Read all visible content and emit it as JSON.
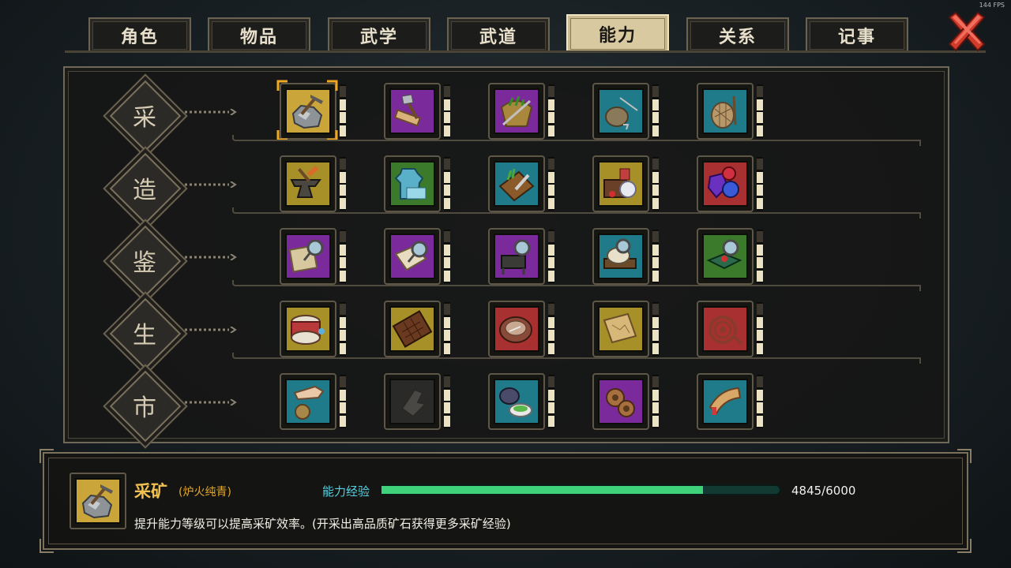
{
  "fps": "144 FPS",
  "tabs": [
    {
      "label": "角色",
      "active": false
    },
    {
      "label": "物品",
      "active": false
    },
    {
      "label": "武学",
      "active": false
    },
    {
      "label": "武道",
      "active": false
    },
    {
      "label": "能力",
      "active": true
    },
    {
      "label": "关系",
      "active": false
    },
    {
      "label": "记事",
      "active": false
    }
  ],
  "close_icon": "close-x-icon",
  "categories": [
    {
      "label": "采",
      "skills": [
        {
          "icon": "mining-pickaxe-ore-icon",
          "frame": "#c9a53a",
          "pips": 3,
          "selected": true
        },
        {
          "icon": "logging-axe-wood-icon",
          "frame": "#7a2a9a",
          "pips": 3
        },
        {
          "icon": "herb-basket-sickle-icon",
          "frame": "#7a2a9a",
          "pips": 3
        },
        {
          "icon": "fishing-rod-bag-icon",
          "frame": "#1f7a8a",
          "pips": 3
        },
        {
          "icon": "hunting-net-icon",
          "frame": "#1f7a8a",
          "pips": 3
        }
      ]
    },
    {
      "label": "造",
      "skills": [
        {
          "icon": "anvil-hammer-icon",
          "frame": "#a89028",
          "pips": 3
        },
        {
          "icon": "tailoring-cloth-icon",
          "frame": "#3a7a2a",
          "pips": 3
        },
        {
          "icon": "cooking-board-knife-icon",
          "frame": "#1f7a8a",
          "pips": 3
        },
        {
          "icon": "alchemy-potions-icon",
          "frame": "#a89028",
          "pips": 3
        },
        {
          "icon": "jewel-crafting-gems-icon",
          "frame": "#a83030",
          "pips": 3
        }
      ]
    },
    {
      "label": "鉴",
      "skills": [
        {
          "icon": "appraise-scroll-icon",
          "frame": "#7a2a9a",
          "pips": 3
        },
        {
          "icon": "appraise-book-icon",
          "frame": "#7a2a9a",
          "pips": 3
        },
        {
          "icon": "appraise-weapon-rack-icon",
          "frame": "#7a2a9a",
          "pips": 3
        },
        {
          "icon": "appraise-relic-icon",
          "frame": "#1f7a8a",
          "pips": 3
        },
        {
          "icon": "appraise-jewelry-box-icon",
          "frame": "#3a7a2a",
          "pips": 3
        }
      ]
    },
    {
      "label": "生",
      "skills": [
        {
          "icon": "drum-instrument-icon",
          "frame": "#a89028",
          "pips": 3
        },
        {
          "icon": "chocolate-bar-icon",
          "frame": "#a89028",
          "pips": 3
        },
        {
          "icon": "bowl-dish-icon",
          "frame": "#a83030",
          "pips": 3
        },
        {
          "icon": "treasure-map-icon",
          "frame": "#a89028",
          "pips": 3
        },
        {
          "icon": "coiled-rope-whip-icon",
          "frame": "#a83030",
          "pips": 3
        }
      ]
    },
    {
      "label": "市",
      "skills": [
        {
          "icon": "hand-money-bag-icon",
          "frame": "#1f7a8a",
          "pips": 3
        },
        {
          "icon": "locked-hand-icon",
          "frame": "#2a2a28",
          "pips": 3,
          "locked": true
        },
        {
          "icon": "tea-bowl-leaf-icon",
          "frame": "#1f7a8a",
          "pips": 3
        },
        {
          "icon": "gear-cogs-icon",
          "frame": "#7a2a9a",
          "pips": 3
        },
        {
          "icon": "horn-icon",
          "frame": "#1f7a8a",
          "pips": 3
        }
      ]
    }
  ],
  "info": {
    "icon": "mining-pickaxe-ore-icon",
    "name": "采矿",
    "subtitle": "(炉火纯青)",
    "xp_label": "能力经验",
    "xp_current": 4845,
    "xp_max": 6000,
    "xp_text": "4845/6000",
    "description": "提升能力等级可以提高采矿效率。(开采出高品质矿石获得更多采矿经验)",
    "colors": {
      "xp_fill": "#3fd27a",
      "xp_track": "#123a32"
    }
  }
}
